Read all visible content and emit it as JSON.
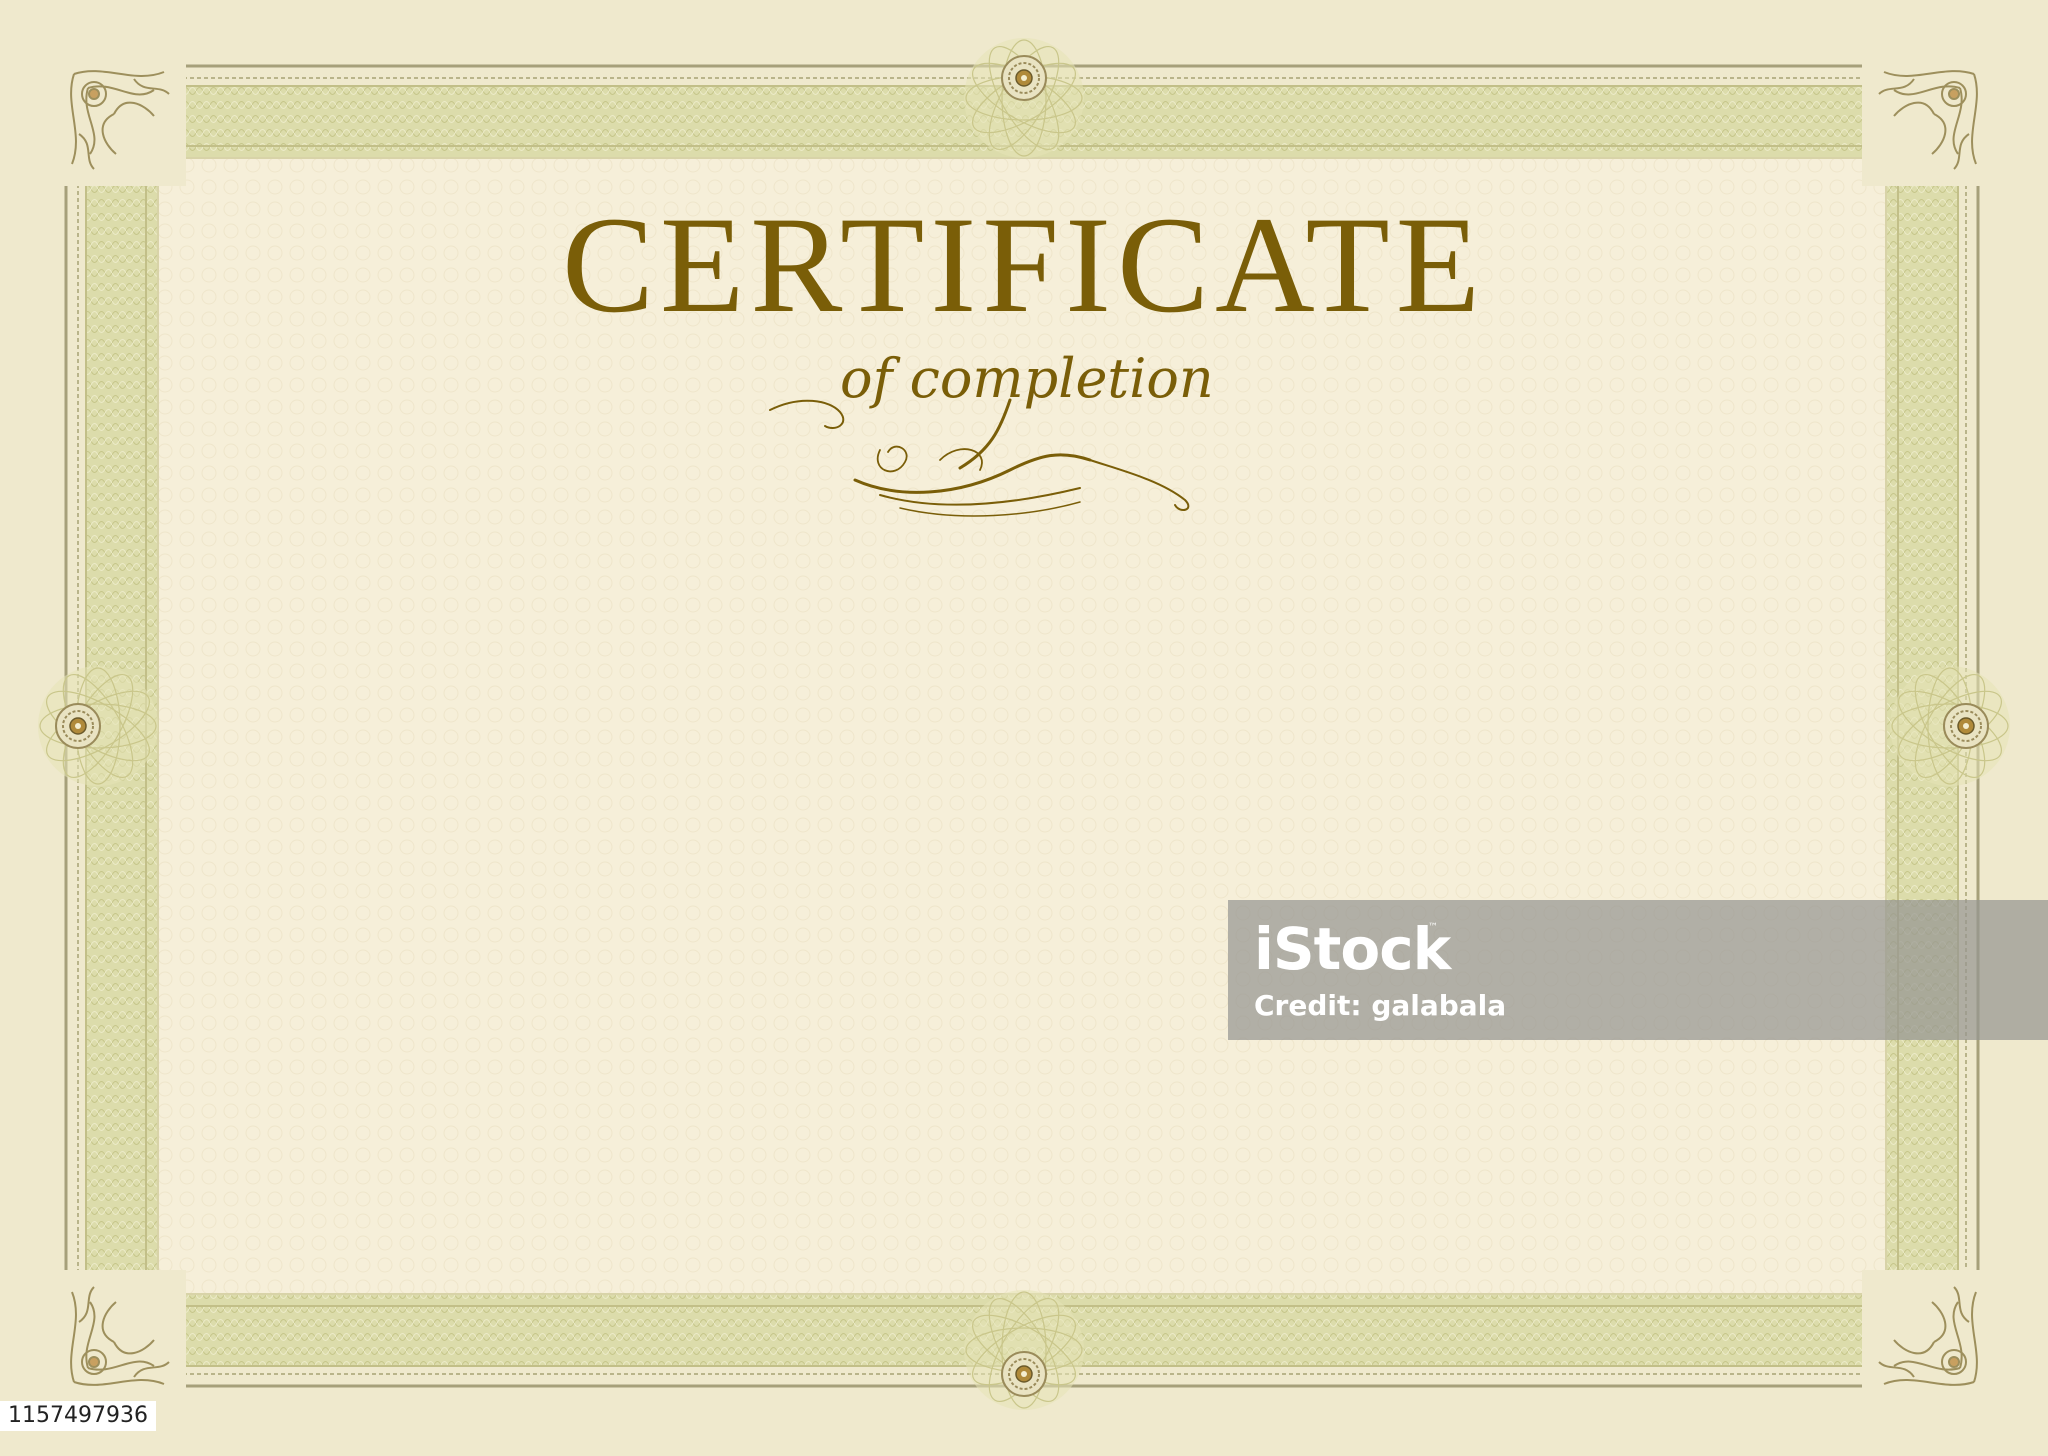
{
  "certificate": {
    "title": "CERTIFICATE",
    "subtitle": "of completion"
  },
  "watermark": {
    "logo": "iStock",
    "trademark": "™",
    "credit": "Credit: galabala"
  },
  "image_id": "1157497936",
  "colors": {
    "background": "#efe9cd",
    "paper": "#f6efd9",
    "border_green": "#d7d7a2",
    "gold_text": "#7a5e08"
  }
}
